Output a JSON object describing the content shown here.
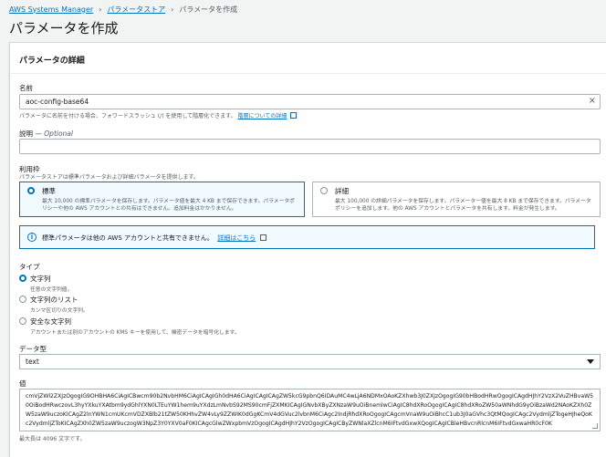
{
  "breadcrumb": {
    "root": "AWS Systems Manager",
    "parent": "パラメータストア",
    "current": "パラメータを作成"
  },
  "page_title": "パラメータを作成",
  "panel_title": "パラメータの詳細",
  "name_field": {
    "label": "名前",
    "value": "aoc-config-base64",
    "hint": "パラメータに名前を付ける場合、フォワードスラッシュ (/) を使用して階層化できます。",
    "hint_link": "階層についての詳細"
  },
  "description_field": {
    "label": "説明",
    "optional": "— Optional",
    "value": ""
  },
  "tier": {
    "label": "利用枠",
    "sub": "パラメータストアは標準パラメータおよび詳細パラメータを提供します。",
    "standard": {
      "title": "標準",
      "desc": "最大 10,000 の標準パラメータを保存します。パラメータ値を最大 4 KB まで保存できます。パラメータポリシーや他の AWS アカウントとの共有はできません。追加料金はかかりません。"
    },
    "advanced": {
      "title": "詳細",
      "desc": "最大 100,000 の詳細パラメータを保存します。パラメーター値を最大 8 KB まで保存できます。パラメータポリシーを追加します。他の AWS アカウントとパラメータを共有します。料金が発生します。"
    }
  },
  "info_alert": {
    "text": "標準パラメータは他の AWS アカウントと共有できません。",
    "link": "詳細はこちら"
  },
  "type": {
    "label": "タイプ",
    "options": [
      {
        "title": "文字列",
        "desc": "任意の文字列値。"
      },
      {
        "title": "文字列のリスト",
        "desc": "カンマ区切りの文字列。"
      },
      {
        "title": "安全な文字列",
        "desc": "アカウントまたは別のアカウントの KMS キーを使用して、機密データを暗号化します。"
      }
    ]
  },
  "data_type": {
    "label": "データ型",
    "value": "text"
  },
  "value_field": {
    "label": "値",
    "value": "cmVjZWl2ZXJzOgogIG9OHBHA6CiAgICBwcm90b2NvbHM6CiAgICAgIGh0dHA6CiAgICAgICAgZW5kcG9pbnQ6IDAuMC4wLjA6NDMxOAoKZXhwb3J0ZXJzOgogIG90bHBodHRwOgogICAgdHJhY2VzX2VuZHBvaW50OiBodHRwczovL3hyYXkuYXAtbm9ydGhlYXN0LTEuYW1hem9uYXdzLmNvbS92MS90cmFjZXMKICAgIGNvbXByZXNzaW9uOiBnemlwCiAgIC8hdXRoOgogICAgIC8hdXRoZW50aWNhdG9yOiBzaWd2NAoKZXh0ZW5zaW9uczoKICAgZ2lnYWN1cmUKcmVDZXBlb21tZW50KHhvZW4vLy9ZZWIK0dGgKCmV4dGVuc2lvbnM6CiAgc2lndjRhdXRoOgogICAgcmVnaW9uOiBhcC1ub3J0aGVhc3QtMQogICAgc2VydmljZTogeHJheQoKc2VydmljZToKICAgZXh0ZW5zaW9uczogW3NpZ3Y0YXV0aF0KICAgcGlwZWxpbmVzOgogICAgdHJhY2VzOgogICAgICByZWNlaXZlcnM6IFtvdGxwXQogICAgICBleHBvcnRlcnM6IFtvdGxwaHR0cF0K",
    "hint": "最大長は 4096 文字です。"
  }
}
